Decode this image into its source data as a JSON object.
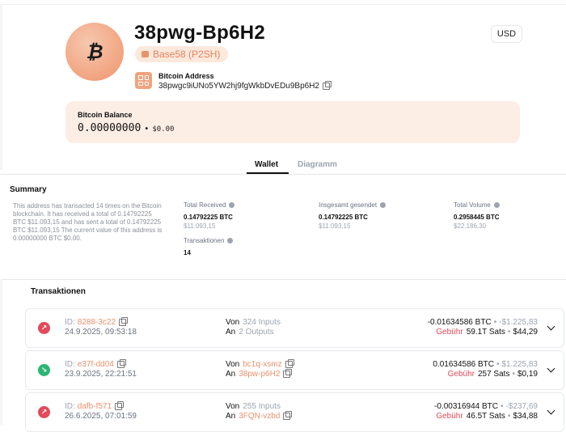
{
  "header": {
    "avatar_glyph": "₿",
    "title": "38pwg-Bp6H2",
    "badge": "Base58 (P2SH)",
    "currency": "USD",
    "address_label": "Bitcoin Address",
    "address": "38pwgc9iUNo5YW2hj9fgWkbDvEDu9Bp6H2"
  },
  "balance": {
    "label": "Bitcoin Balance",
    "btc": "0.00000000",
    "separator": "•",
    "usd": "$0.00"
  },
  "tabs": [
    {
      "label": "Wallet",
      "active": true
    },
    {
      "label": "Diagramm",
      "active": false
    }
  ],
  "summary": {
    "title": "Summary",
    "text": "This address has transacted 14 times on the Bitcoin blockchain. It has received a total of 0.14792225 BTC $11.093,15 and has sent a total of 0.14792225 BTC $11.093,15 The current value of this address is 0.00000000 BTC $0.00.",
    "stats": {
      "total_received": {
        "label": "Total Received",
        "btc": "0.14792225 BTC",
        "usd": "$11.093,15"
      },
      "total_sent": {
        "label": "Insgesamt gesendet",
        "btc": "0.14792225 BTC",
        "usd": "$11.093,15"
      },
      "total_volume": {
        "label": "Total Volume",
        "btc": "0.2958445 BTC",
        "usd": "$22.186,30"
      },
      "transactions": {
        "label": "Transaktionen",
        "value": "14"
      }
    }
  },
  "transactions": {
    "title": "Transaktionen",
    "items": [
      {
        "direction": "out",
        "id_label": "ID:",
        "id": "8288-3c22",
        "date": "24.9.2025, 09:53:18",
        "from_label": "Von",
        "from": "324 Inputs",
        "to_label": "An",
        "to": "2 Outputs",
        "amount": "-0.01634586 BTC",
        "sep": "•",
        "amount_usd": "-$1.225,83",
        "fee_label": "Gebühr",
        "fee": "59.1T Sats",
        "fee_usd": "$44,29"
      },
      {
        "direction": "in",
        "id_label": "ID:",
        "id": "e37f-dd04",
        "date": "23.9.2025, 22:21:51",
        "from_label": "Von",
        "from": "bc1q-xsmz",
        "to_label": "An",
        "to": "38pw-p6H2",
        "amount": "0.01634586 BTC",
        "sep": "•",
        "amount_usd": "$1.225,83",
        "fee_label": "Gebühr",
        "fee": "257 Sats",
        "fee_usd": "$0,19"
      },
      {
        "direction": "out",
        "id_label": "ID:",
        "id": "dafb-f571",
        "date": "26.6.2025, 07:01:59",
        "from_label": "Von",
        "from": "255 Inputs",
        "to_label": "An",
        "to": "3FQN-vzbd",
        "amount": "-0.00316944 BTC",
        "sep": "•",
        "amount_usd": "-$237,69",
        "fee_label": "Gebühr",
        "fee": "46.5T Sats",
        "fee_usd": "$34,88"
      }
    ]
  }
}
